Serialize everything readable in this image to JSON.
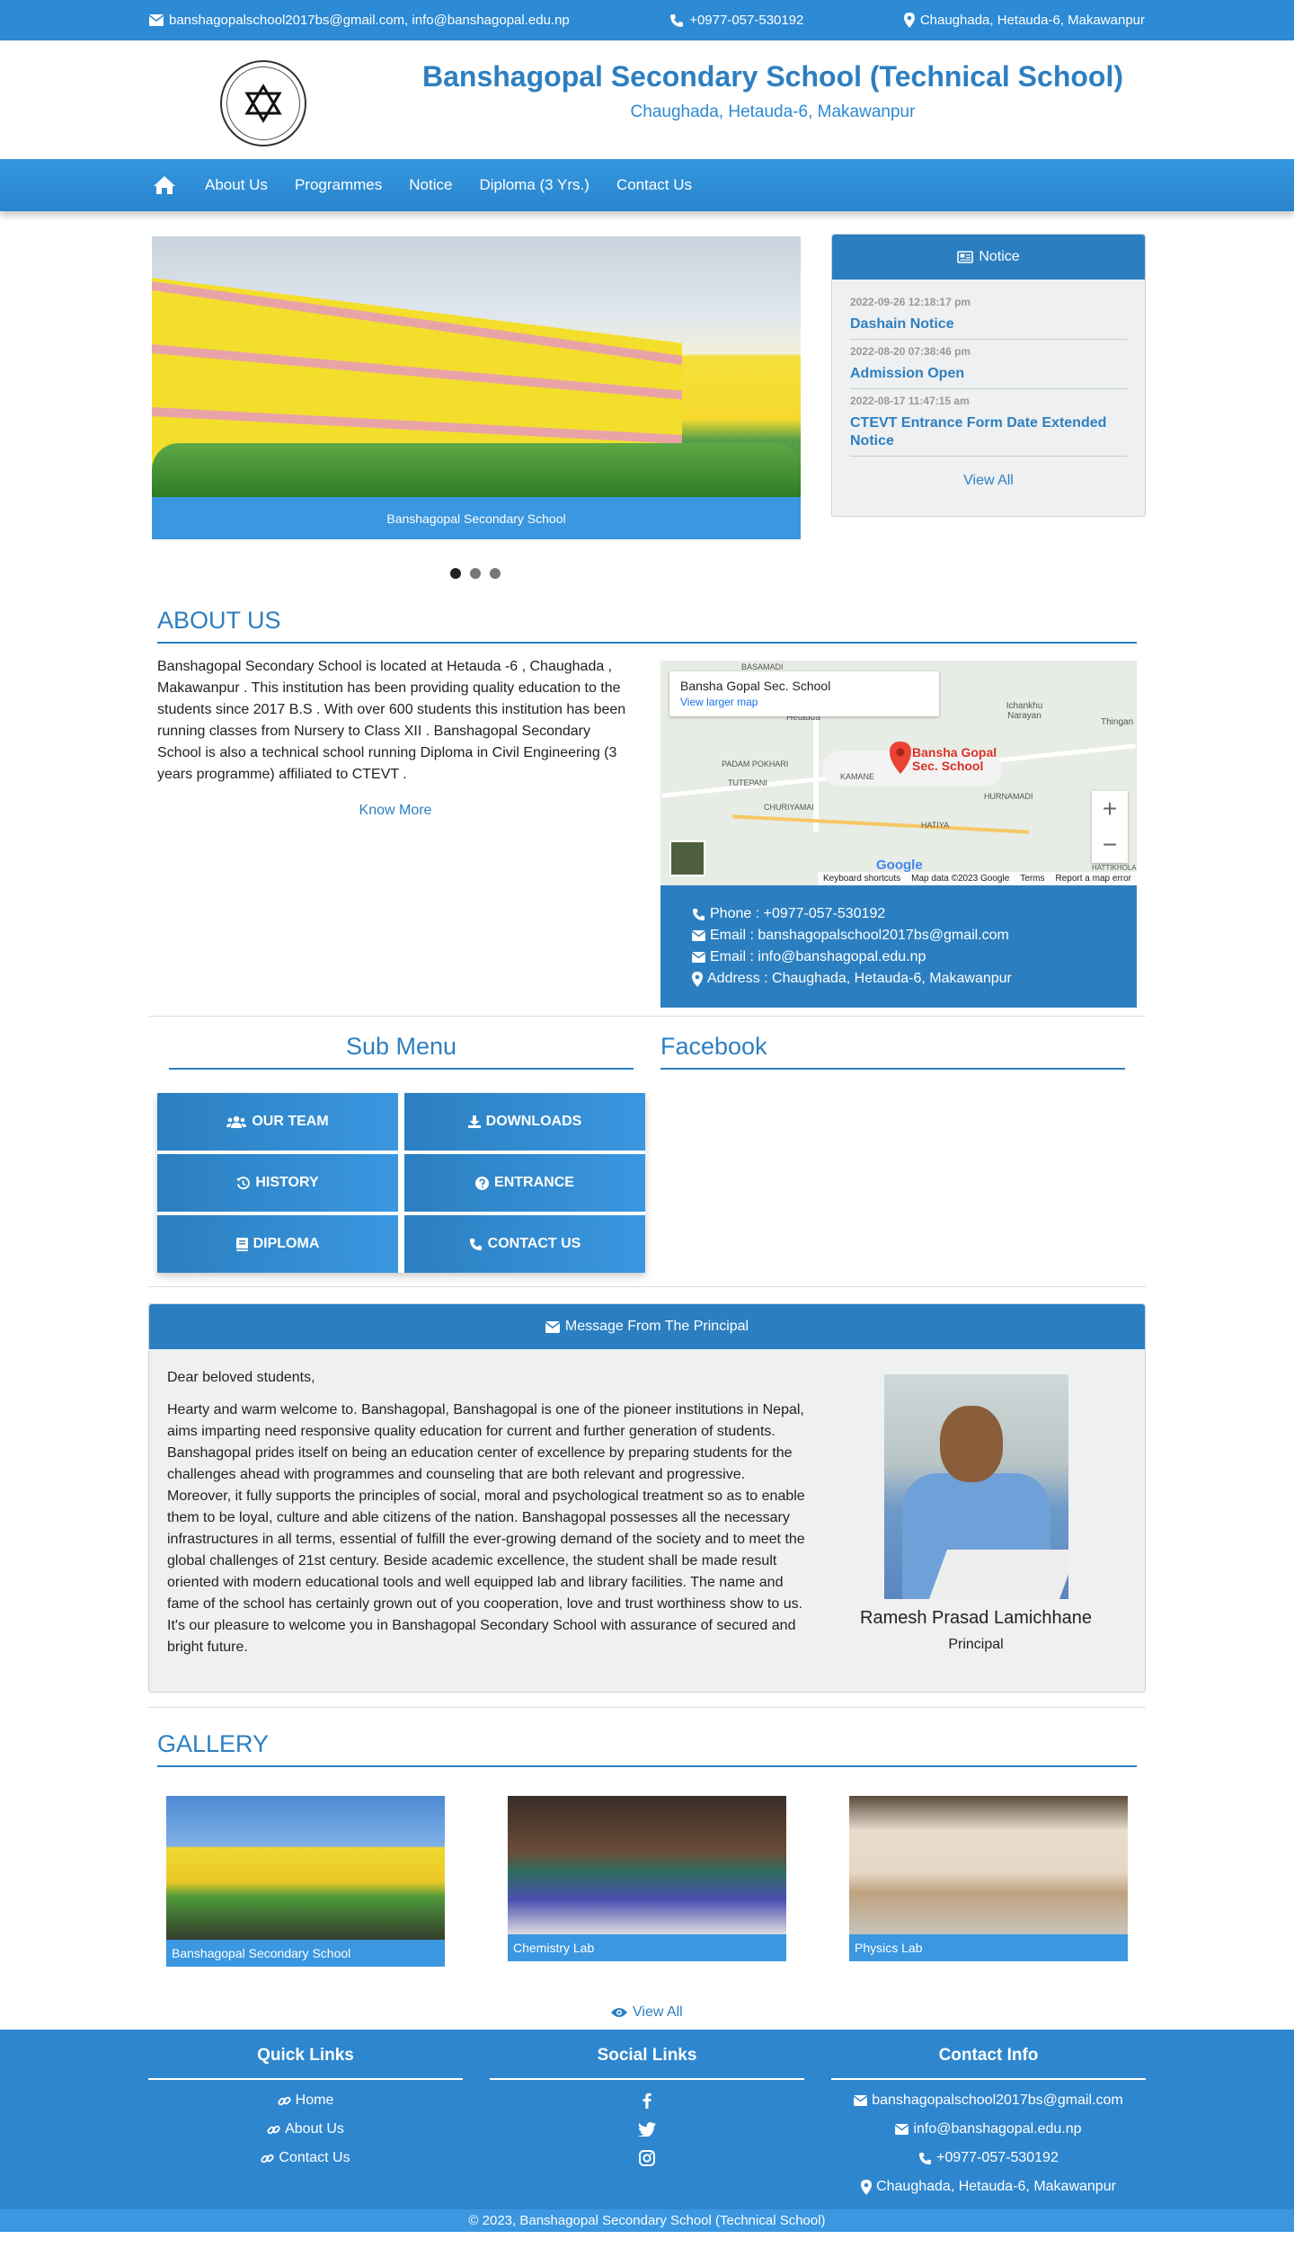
{
  "topbar": {
    "emails": "banshagopalschool2017bs@gmail.com, info@banshagopal.edu.np",
    "phone": "+0977-057-530192",
    "address": "Chaughada, Hetauda-6, Makawanpur"
  },
  "header": {
    "title": "Banshagopal Secondary School (Technical School)",
    "subtitle": "Chaughada, Hetauda-6, Makawanpur"
  },
  "nav": {
    "items": [
      "About Us",
      "Programmes",
      "Notice",
      "Diploma (3 Yrs.)",
      "Contact Us"
    ]
  },
  "carousel": {
    "caption": "Banshagopal Secondary School",
    "active_index": 0,
    "slide_count": 3
  },
  "notice": {
    "heading": "Notice",
    "items": [
      {
        "date": "2022-09-26 12:18:17 pm",
        "title": "Dashain Notice"
      },
      {
        "date": "2022-08-20 07:38:46 pm",
        "title": "Admission Open"
      },
      {
        "date": "2022-08-17 11:47:15 am",
        "title": "CTEVT Entrance Form Date Extended Notice"
      }
    ],
    "view_all": "View All"
  },
  "about": {
    "heading": "ABOUT US",
    "text": "Banshagopal Secondary School is located at Hetauda -6 , Chaughada , Makawanpur . This institution has been providing quality education to the students since 2017 B.S . With over 600 students this institution has been running classes from Nursery to Class XII . Banshagopal Secondary School is also a technical school running Diploma in Civil Engineering (3 years programme) affiliated to CTEVT .",
    "know_more": "Know More"
  },
  "map": {
    "place_name": "Bansha Gopal Sec. School",
    "larger_map": "View larger map",
    "pin_label_1": "Bansha Gopal",
    "pin_label_2": "Sec. School",
    "labels": [
      "Hetauda",
      "PADAM POKHARI",
      "TUTEPANI",
      "KAMANE",
      "CHURIYAMAI",
      "HATIYA",
      "HURNAMADI",
      "Ichankhu Narayan",
      "Thingan",
      "BASAMADI",
      "HATTIKHOLA"
    ],
    "google": "Google",
    "attribution": [
      "Keyboard shortcuts",
      "Map data ©2023 Google",
      "Terms",
      "Report a map error"
    ]
  },
  "contact_box": {
    "phone": "Phone : +0977-057-530192",
    "email1": "Email : banshagopalschool2017bs@gmail.com",
    "email2": "Email : info@banshagopal.edu.np",
    "address": "Address : Chaughada, Hetauda-6, Makawanpur"
  },
  "submenu": {
    "heading": "Sub Menu",
    "buttons": [
      "OUR TEAM",
      "DOWNLOADS",
      "HISTORY",
      "ENTRANCE",
      "DIPLOMA",
      "CONTACT US"
    ]
  },
  "facebook": {
    "heading": "Facebook"
  },
  "principal": {
    "heading": "Message From The Principal",
    "greeting": "Dear beloved students,",
    "message": "Hearty and warm welcome to. Banshagopal, Banshagopal is one of the pioneer institutions in Nepal, aims imparting need responsive quality education for current and further generation of students. Banshagopal prides itself on being an education center of excellence by preparing students for the challenges ahead with programmes and counseling that are both relevant and progressive. Moreover, it fully supports the principles of social, moral and psychological treatment so as to enable them to be loyal, culture and able citizens of the nation. Banshagopal possesses all the necessary infrastructures in all terms, essential of fulfill the ever-growing demand of the society and to meet the global challenges of 21st century. Beside academic excellence, the student shall be made result oriented with modern educational tools and well equipped lab and library facilities. The name and fame of the school has certainly grown out of you cooperation, love and trust worthiness show to us. It's our pleasure to welcome you in Banshagopal Secondary School with assurance of secured and bright future.",
    "name": "Ramesh Prasad Lamichhane",
    "role": "Principal"
  },
  "gallery": {
    "heading": "GALLERY",
    "items": [
      "Banshagopal Secondary School",
      "Chemistry Lab",
      "Physics Lab"
    ],
    "view_all": "View All"
  },
  "footer": {
    "quick_links": {
      "heading": "Quick Links",
      "items": [
        "Home",
        "About Us",
        "Contact Us"
      ]
    },
    "social": {
      "heading": "Social Links"
    },
    "contact": {
      "heading": "Contact Info",
      "email1": "banshagopalschool2017bs@gmail.com",
      "email2": "info@banshagopal.edu.np",
      "phone": "+0977-057-530192",
      "address": "Chaughada, Hetauda-6, Makawanpur"
    },
    "copyright": "© 2023, Banshagopal Secondary School (Technical School)"
  },
  "colors": {
    "primary": "#2d7fc1",
    "accent": "#3a97e0",
    "map_pin": "#d93025"
  }
}
